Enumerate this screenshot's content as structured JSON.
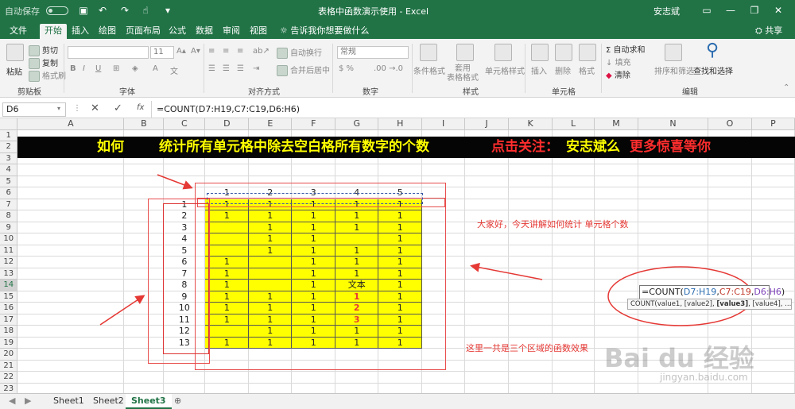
{
  "title_bar": {
    "autosave": "自动保存",
    "file_title": "表格中函数演示使用 - Excel",
    "user": "安志斌"
  },
  "ribbon_tabs": [
    "文件",
    "开始",
    "插入",
    "绘图",
    "页面布局",
    "公式",
    "数据",
    "审阅",
    "视图"
  ],
  "tell_me": "告诉我你想要做什么",
  "share": "共享",
  "ribbon": {
    "clipboard": {
      "label": "剪贴板",
      "paste": "粘贴",
      "cut": "剪切",
      "copy": "复制",
      "format_painter": "格式刷"
    },
    "font": {
      "label": "字体",
      "size": "11"
    },
    "alignment": {
      "label": "对齐方式",
      "wrap": "自动换行",
      "merge": "合并后居中"
    },
    "number": {
      "label": "数字",
      "format": "常规"
    },
    "styles": {
      "label": "样式",
      "conditional": "条件格式",
      "table": "套用\n表格格式",
      "cell_styles": "单元格样式"
    },
    "cells": {
      "label": "单元格",
      "insert": "插入",
      "delete": "删除",
      "format": "格式"
    },
    "editing": {
      "label": "编辑",
      "autosum": "自动求和",
      "fill": "填充",
      "clear": "清除",
      "sort": "排序和筛选",
      "find": "查找和选择"
    }
  },
  "formula_bar": {
    "name_box": "D6",
    "formula": "=COUNT(D7:H19,C7:C19,D6:H6)"
  },
  "columns": [
    "A",
    "B",
    "C",
    "D",
    "E",
    "F",
    "G",
    "H",
    "I",
    "J",
    "K",
    "L",
    "M",
    "N",
    "O",
    "P"
  ],
  "rows": [
    "1",
    "2",
    "3",
    "4",
    "5",
    "6",
    "7",
    "8",
    "9",
    "10",
    "11",
    "12",
    "13",
    "14",
    "15",
    "16",
    "17",
    "18",
    "19",
    "20",
    "21",
    "22",
    "23"
  ],
  "banner": {
    "part1": "如何",
    "part2": "统计所有单元格中除去空白格所有数字的个数",
    "part3": "点击关注：",
    "part4": "安志斌么",
    "part5": "更多惊喜等你"
  },
  "header_row": [
    "1",
    "2",
    "3",
    "4",
    "5"
  ],
  "row_numbers": [
    "1",
    "2",
    "3",
    "4",
    "5",
    "6",
    "7",
    "8",
    "9",
    "10",
    "11",
    "12",
    "13"
  ],
  "matrix": [
    [
      "1",
      "1",
      "1",
      "1",
      "1"
    ],
    [
      "1",
      "1",
      "1",
      "1",
      "1"
    ],
    [
      "",
      "1",
      "1",
      "1",
      "1"
    ],
    [
      "",
      "1",
      "1",
      "",
      "1"
    ],
    [
      "",
      "1",
      "1",
      "1",
      "1"
    ],
    [
      "1",
      "",
      "1",
      "1",
      "1"
    ],
    [
      "1",
      "",
      "1",
      "1",
      "1"
    ],
    [
      "1",
      "",
      "1",
      "文本",
      "1"
    ],
    [
      "1",
      "1",
      "1",
      "1",
      "1"
    ],
    [
      "1",
      "1",
      "1",
      "2",
      "1"
    ],
    [
      "1",
      "1",
      "1",
      "3",
      "1"
    ],
    [
      "",
      "1",
      "1",
      "1",
      "1"
    ],
    [
      "1",
      "1",
      "1",
      "1",
      "1"
    ]
  ],
  "red_text_cells": [
    "8-3",
    "9-3",
    "10-3"
  ],
  "notes": {
    "intro": "大家好，今天讲解如何统计 单元格个数",
    "three_regions": "这里一共是三个区域的函数效果"
  },
  "edit_formula": {
    "prefix": "=COUNT(",
    "ref1": "D7:H19",
    "comma1": ",",
    "ref2": "C7:C19",
    "comma2": ",",
    "ref3": "D6:H6",
    "suffix": ")"
  },
  "tooltip": {
    "t1": "COUNT(value1, [value2], ",
    "t2": "[value3]",
    "t3": ", [value4], ...)"
  },
  "sheets": [
    "Sheet1",
    "Sheet2",
    "Sheet3"
  ],
  "watermark": {
    "brand": "Bai du 经验",
    "url": "jingyan.baidu.com"
  },
  "colors": {
    "excel_green": "#217346",
    "highlight_yellow": "#ffff00",
    "annotation_red": "#e53935",
    "banner_bg": "#050505",
    "banner_yellow": "#ffff00"
  }
}
